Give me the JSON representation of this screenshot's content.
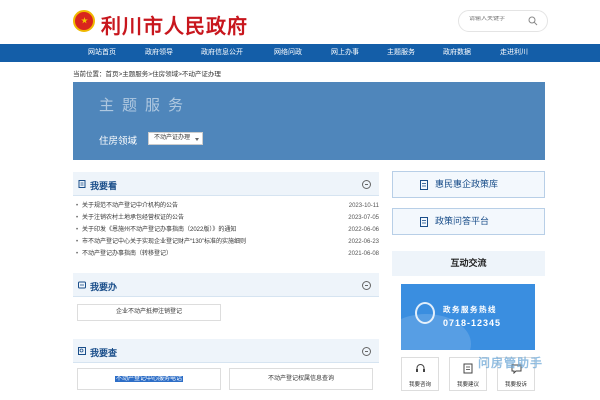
{
  "header": {
    "site_title": "利川市人民政府",
    "search_placeholder": "请输入关键字"
  },
  "nav": {
    "items": [
      "网站首页",
      "政府领导",
      "政府信息公开",
      "网络问政",
      "网上办事",
      "主题服务",
      "政府数据",
      "走进利川"
    ]
  },
  "breadcrumb": {
    "prefix": "当前位置：",
    "path": "首页>主题服务>住房领域>不动产证办理"
  },
  "banner": {
    "title": "主题服务",
    "label": "住房领域",
    "select_value": "不动产证办理"
  },
  "woyaokan": {
    "title": "我要看",
    "items": [
      {
        "title": "关于规范不动产登记中介机构的公告",
        "date": "2023-10-11"
      },
      {
        "title": "关于注销农村土地承包经营权证的公告",
        "date": "2023-07-05"
      },
      {
        "title": "关于印发《恩施州不动产登记办事指南（2022版）》的通知",
        "date": "2022-06-06"
      },
      {
        "title": "市不动产登记中心关于实现企业登记财产“130”标准的实施细则",
        "date": "2022-06-23"
      },
      {
        "title": "不动产登记办事指南（转移登记）",
        "date": "2021-06-08"
      }
    ]
  },
  "woyaoban": {
    "title": "我要办",
    "items": [
      "企业不动产抵押注销登记"
    ]
  },
  "woyaocha": {
    "title": "我要查",
    "items": [
      "不动产登记中心服务电话",
      "不动产登记权属信息查询"
    ]
  },
  "right": {
    "policy_btn": "惠民惠企政策库",
    "qa_btn": "政策问答平台",
    "hudong_title": "互动交流",
    "hotline_title": "政务服务热线",
    "hotline_number": "0718-12345",
    "tiles": [
      "我要咨询",
      "我要建议",
      "我要投诉"
    ],
    "watermark": "问房管助手"
  },
  "colors": {
    "brand_red": "#c8161d",
    "nav_blue": "#145ea8",
    "banner_blue": "#4f86bb",
    "section_bg": "#eef4fa"
  }
}
